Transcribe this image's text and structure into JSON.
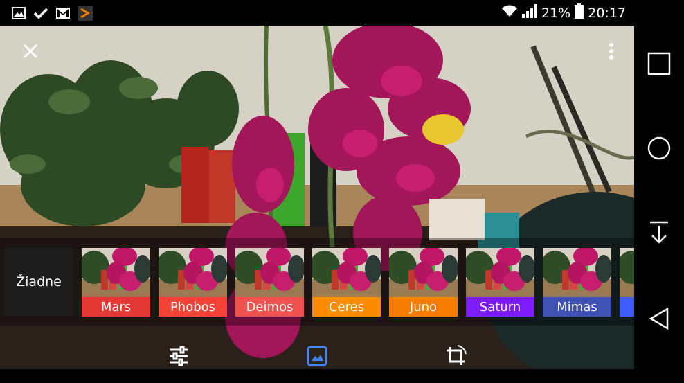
{
  "status_bar": {
    "battery": "21%",
    "time": "20:17",
    "notification_icons": [
      "gallery-icon",
      "check-icon",
      "gmail-icon",
      "app-icon"
    ],
    "system_icons": [
      "wifi-icon",
      "signal-icon",
      "battery-icon"
    ]
  },
  "editor": {
    "close_icon": "close-icon",
    "more_icon": "more-vertical-icon"
  },
  "filters": {
    "none_label": "Žiadne",
    "items": [
      {
        "label": "Mars",
        "color": "#e53935"
      },
      {
        "label": "Phobos",
        "color": "#f44336"
      },
      {
        "label": "Deimos",
        "color": "#ef5350"
      },
      {
        "label": "Ceres",
        "color": "#fb8c00"
      },
      {
        "label": "Juno",
        "color": "#f57c00"
      },
      {
        "label": "Saturn",
        "color": "#7c1bff"
      },
      {
        "label": "Mimas",
        "color": "#3f51b5"
      },
      {
        "label": "",
        "color": "#3d5afe"
      }
    ]
  },
  "toolbar": {
    "tools": [
      {
        "icon": "tune-sliders-icon",
        "active": false
      },
      {
        "icon": "image-filter-icon",
        "active": true
      },
      {
        "icon": "crop-rotate-icon",
        "active": false
      }
    ],
    "active_color": "#4285f4"
  },
  "navigation": {
    "buttons": [
      "recent-apps-icon",
      "home-icon",
      "download-icon",
      "back-icon"
    ]
  }
}
